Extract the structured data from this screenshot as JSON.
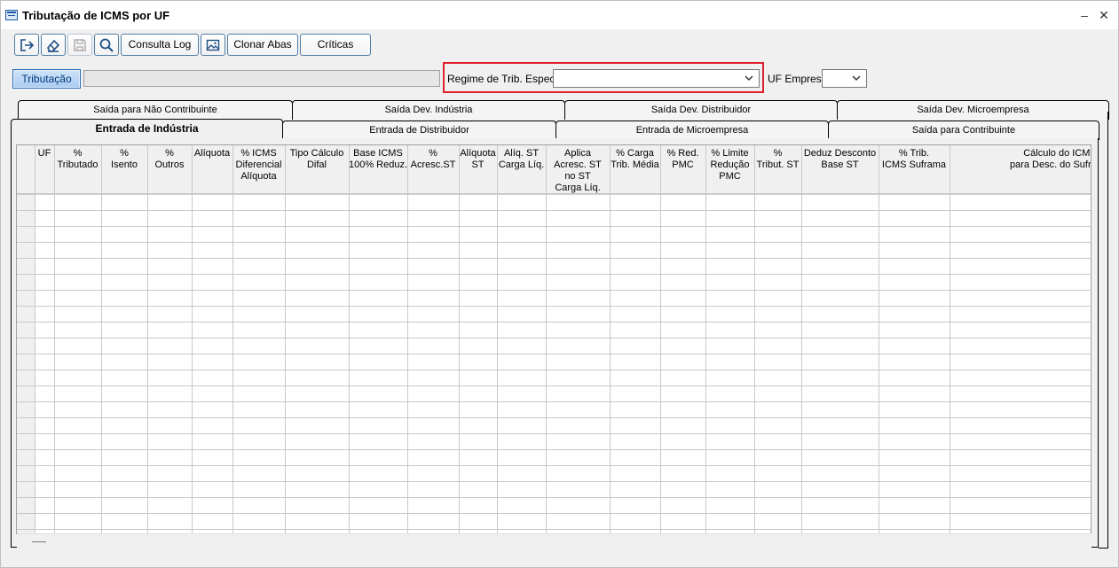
{
  "window": {
    "title": "Tributação de ICMS por UF",
    "minimize_glyph": "–",
    "close_glyph": "✕"
  },
  "toolbar": {
    "icons": [
      "exit-icon",
      "eraser-icon",
      "save-icon",
      "search-icon",
      "image-icon"
    ],
    "consulta_log": "Consulta Log",
    "clonar_abas": "Clonar Abas",
    "criticas": "Críticas"
  },
  "filters": {
    "tributacao_button": "Tributação",
    "tributacao_value": "",
    "regime_label": "Regime de Trib. Especial",
    "regime_value": "",
    "uf_label": "UF Empresa",
    "uf_value": ""
  },
  "tabs_back": [
    "Saída para Não Contribuinte",
    "Saída Dev. Indústria",
    "Saída Dev. Distribuidor",
    "Saída Dev. Microempresa"
  ],
  "tabs_front": [
    "Entrada de Indústria",
    "Entrada de Distribuidor",
    "Entrada de Microempresa",
    "Saída para Contribuinte"
  ],
  "active_tab": "Entrada de Indústria",
  "grid": {
    "columns": [
      "",
      "UF",
      "%\nTributado",
      "%\nIsento",
      "%\nOutros",
      "Alíquota",
      "% ICMS\nDiferencial\nAlíquota",
      "Tipo Cálculo\nDifal",
      "Base ICMS\n100% Reduz.",
      "%\nAcresc.ST",
      "Alíquota\nST",
      "Alíq. ST\nCarga Líq.",
      "Aplica\nAcresc. ST\nno ST\nCarga Líq.",
      "% Carga\nTrib. Média",
      "% Red.\nPMC",
      "% Limite\nRedução\nPMC",
      "%\nTribut. ST",
      "Deduz Desconto\nBase ST",
      "% Trib.\nICMS Suframa",
      "Cálculo do ICMS\npara Desc. do Suframa"
    ],
    "row_count": 21
  }
}
